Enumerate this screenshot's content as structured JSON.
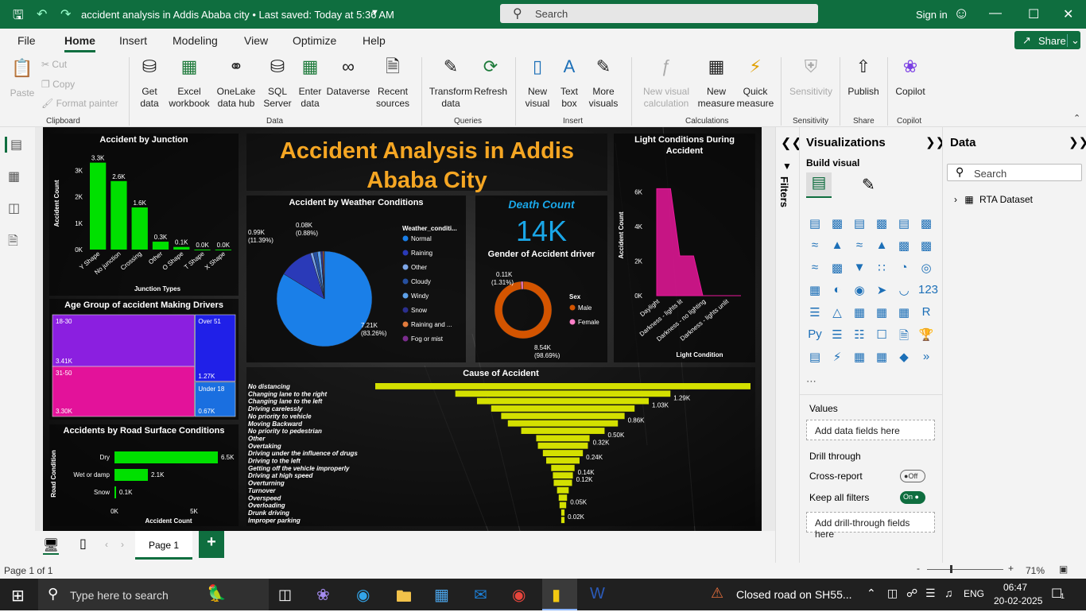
{
  "titlebar": {
    "doc_title": "accident analysis in Addis Ababa city • Last saved: Today at 5:36 AM",
    "search_placeholder": "Search",
    "signin": "Sign in"
  },
  "menu": [
    "File",
    "Home",
    "Insert",
    "Modeling",
    "View",
    "Optimize",
    "Help"
  ],
  "share": "Share",
  "ribbon": {
    "clipboard": {
      "paste": "Paste",
      "cut": "Cut",
      "copy": "Copy",
      "format_painter": "Format painter",
      "group": "Clipboard"
    },
    "data": {
      "get_data": "Get data",
      "excel": "Excel workbook",
      "onelake": "OneLake data hub",
      "sql": "SQL Server",
      "enter": "Enter data",
      "dataverse": "Dataverse",
      "recent": "Recent sources",
      "group": "Data"
    },
    "queries": {
      "transform": "Transform data",
      "refresh": "Refresh",
      "group": "Queries"
    },
    "insert": {
      "new_visual": "New visual",
      "text_box": "Text box",
      "more_visuals": "More visuals",
      "group": "Insert"
    },
    "calculations": {
      "new_visual_calc": "New visual calculation",
      "new_measure": "New measure",
      "quick_measure": "Quick measure",
      "group": "Calculations"
    },
    "sensitivity": {
      "label": "Sensitivity",
      "group": "Sensitivity"
    },
    "share": {
      "publish": "Publish",
      "group": "Share"
    },
    "copilot": {
      "label": "Copilot",
      "group": "Copilot"
    }
  },
  "report": {
    "title_line1": "Accident Analysis in Addis",
    "title_line2": "Ababa City",
    "death_label": "Death Count",
    "death_value": "14K"
  },
  "chart_data": [
    {
      "type": "bar",
      "title": "Accident by Junction",
      "xlabel": "Junction Types",
      "ylabel": "Accident Count",
      "categories": [
        "Y Shape",
        "No junction",
        "Crossing",
        "Other",
        "O Shape",
        "T Shape",
        "X Shape"
      ],
      "values": [
        3300,
        2600,
        1600,
        300,
        100,
        0,
        0
      ],
      "labels": [
        "3.3K",
        "2.6K",
        "1.6K",
        "0.3K",
        "0.1K",
        "0.0K",
        "0.0K"
      ],
      "yticks": [
        "0K",
        "1K",
        "2K",
        "3K"
      ],
      "ylim": [
        0,
        3500
      ],
      "color": "#00e000"
    },
    {
      "type": "pie",
      "title": "Accident by Weather Conditions",
      "legend_title": "Weather_conditi...",
      "categories": [
        "Normal",
        "Raining",
        "Other",
        "Cloudy",
        "Windy",
        "Snow",
        "Raining and ...",
        "Fog or mist"
      ],
      "colors": [
        "#1a7fe8",
        "#2a3ab8",
        "#7ea7e8",
        "#2650a0",
        "#5da0e8",
        "#2b2f8e",
        "#e27b3c",
        "#7b2d8e"
      ],
      "values": [
        7210,
        990,
        80,
        125,
        98,
        61,
        35,
        10
      ],
      "labels": [
        {
          "text": "7.21K",
          "sub": "(83.26%)"
        },
        {
          "text": "0.99K",
          "sub": "(11.39%)"
        },
        {
          "text": "0.08K",
          "sub": "(0.88%)"
        }
      ]
    },
    {
      "type": "pie",
      "title": "Gender of Accident driver",
      "legend_title": "Sex",
      "categories": [
        "Male",
        "Female"
      ],
      "colors": [
        "#d35400",
        "#ff7fc8"
      ],
      "values": [
        8540,
        110
      ],
      "labels": [
        {
          "text": "8.54K",
          "sub": "(98.69%)"
        },
        {
          "text": "0.11K",
          "sub": "(1.31%)"
        }
      ]
    },
    {
      "type": "area",
      "title": "Light Conditions During Accident",
      "xlabel": "Light Condition",
      "ylabel": "Accident Count",
      "categories": [
        "Daylight",
        "Darkness - lights lit",
        "Darkness - no lighting",
        "Darkness - lights unlit"
      ],
      "values": [
        6200,
        2300,
        0,
        0
      ],
      "yticks": [
        "0K",
        "2K",
        "4K",
        "6K"
      ],
      "ylim": [
        0,
        7000
      ],
      "color": "#e8189a"
    },
    {
      "type": "heatmap",
      "title": "Age Group of accident Making Drivers",
      "categories": [
        "18-30",
        "31-50",
        "Over 51",
        "Under 18"
      ],
      "values": [
        3410,
        3300,
        1270,
        670
      ],
      "labels": [
        "3.41K",
        "3.30K",
        "1.27K",
        "0.67K"
      ],
      "colors": [
        "#8b1fe0",
        "#e3129a",
        "#2020e8",
        "#1a6fe0"
      ]
    },
    {
      "type": "bar",
      "title": "Accidents by Road Surface Conditions",
      "xlabel": "Accident Count",
      "ylabel": "Road Condition",
      "categories": [
        "Dry",
        "Wet or damp",
        "Snow"
      ],
      "values": [
        6500,
        2100,
        100
      ],
      "labels": [
        "6.5K",
        "2.1K",
        "0.1K"
      ],
      "xticks": [
        "0K",
        "5K"
      ],
      "xlim": [
        0,
        7000
      ],
      "color": "#00e000"
    },
    {
      "type": "bar",
      "title": "Cause of Accident",
      "categories": [
        "No distancing",
        "Changing lane to the right",
        "Changing lane to the left",
        "Driving carelessly",
        "No priority to vehicle",
        "Moving Backward",
        "No priority to pedestrian",
        "Other",
        "Overtaking",
        "Driving under the influence of drugs",
        "Driving to the left",
        "Getting off the vehicle improperly",
        "Driving at high speed",
        "Overturning",
        "Turnover",
        "Overspeed",
        "Overloading",
        "Drunk driving",
        "Improper parking"
      ],
      "values": [
        2250,
        1290,
        1030,
        860,
        740,
        660,
        500,
        320,
        300,
        240,
        200,
        140,
        120,
        110,
        70,
        50,
        40,
        20,
        20
      ],
      "labels": [
        "",
        "1.29K",
        "1.03K",
        "",
        "0.86K",
        "",
        "0.50K",
        "0.32K",
        "",
        "0.24K",
        "",
        "0.14K",
        "0.12K",
        "",
        "",
        "0.05K",
        "",
        "0.02K",
        ""
      ],
      "color": "#d4e000"
    }
  ],
  "visualizations": {
    "title": "Visualizations",
    "build": "Build visual",
    "values": "Values",
    "add_data": "Add data fields here",
    "drill": "Drill through",
    "cross": "Cross-report",
    "cross_state": "Off",
    "keep": "Keep all filters",
    "keep_state": "On",
    "add_drill": "Add drill-through fields here"
  },
  "filters_label": "Filters",
  "data_pane": {
    "title": "Data",
    "search": "Search",
    "dataset": "RTA Dataset"
  },
  "page_tab": "Page 1",
  "status": {
    "page": "Page 1 of 1",
    "zoom": "71%"
  },
  "taskbar": {
    "search": "Type here to search",
    "news": "Closed road on SH55...",
    "lang": "ENG",
    "time": "06:47",
    "date": "20-02-2025",
    "notif": "1"
  }
}
